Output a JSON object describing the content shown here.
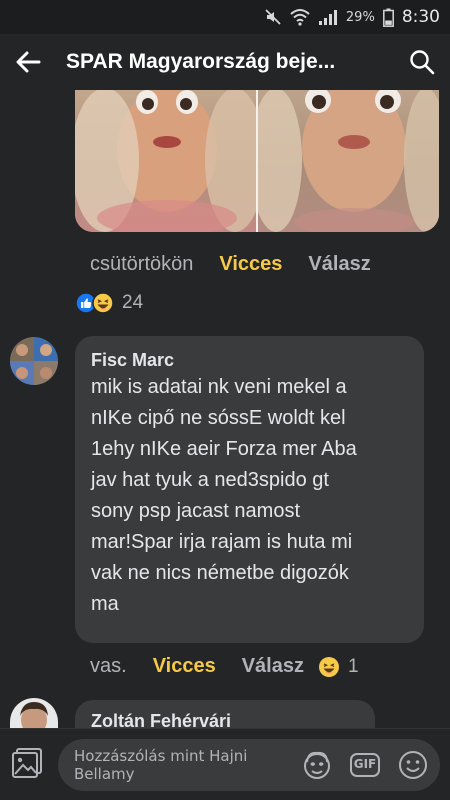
{
  "status_bar": {
    "battery_percent": "29%",
    "time": "8:30"
  },
  "header": {
    "title": "SPAR Magyarország beje..."
  },
  "post_meta": {
    "time": "csütörtökön",
    "reaction_label": "Vicces",
    "reply_label": "Válasz"
  },
  "post_reactions": {
    "count": "24"
  },
  "comments": [
    {
      "author": "Fisc Marc",
      "lines": [
        "mik is adatai nk veni mekel a",
        "nIKe cipő ne sóssE woldt kel",
        "1ehy nIKe aeir Forza mer Aba",
        "jav hat tyuk a ned3spido gt",
        "sony psp jacast namost",
        "mar!Spar irja rajam is huta mi",
        "vak ne nics németbe digozók",
        "ma"
      ],
      "time": "vas.",
      "reaction_label": "Vicces",
      "reply_label": "Válasz",
      "reaction_count": "1"
    },
    {
      "author": "Zoltán Fehérvári"
    }
  ],
  "composer": {
    "placeholder_line1": "Hozzászólás mint Hajni",
    "placeholder_line2": "Bellamy",
    "gif_label": "GIF"
  },
  "colors": {
    "background": "#242526",
    "bubble": "#3a3b3c",
    "reaction_active": "#f7c948",
    "muted_text": "#b0b3b8"
  }
}
